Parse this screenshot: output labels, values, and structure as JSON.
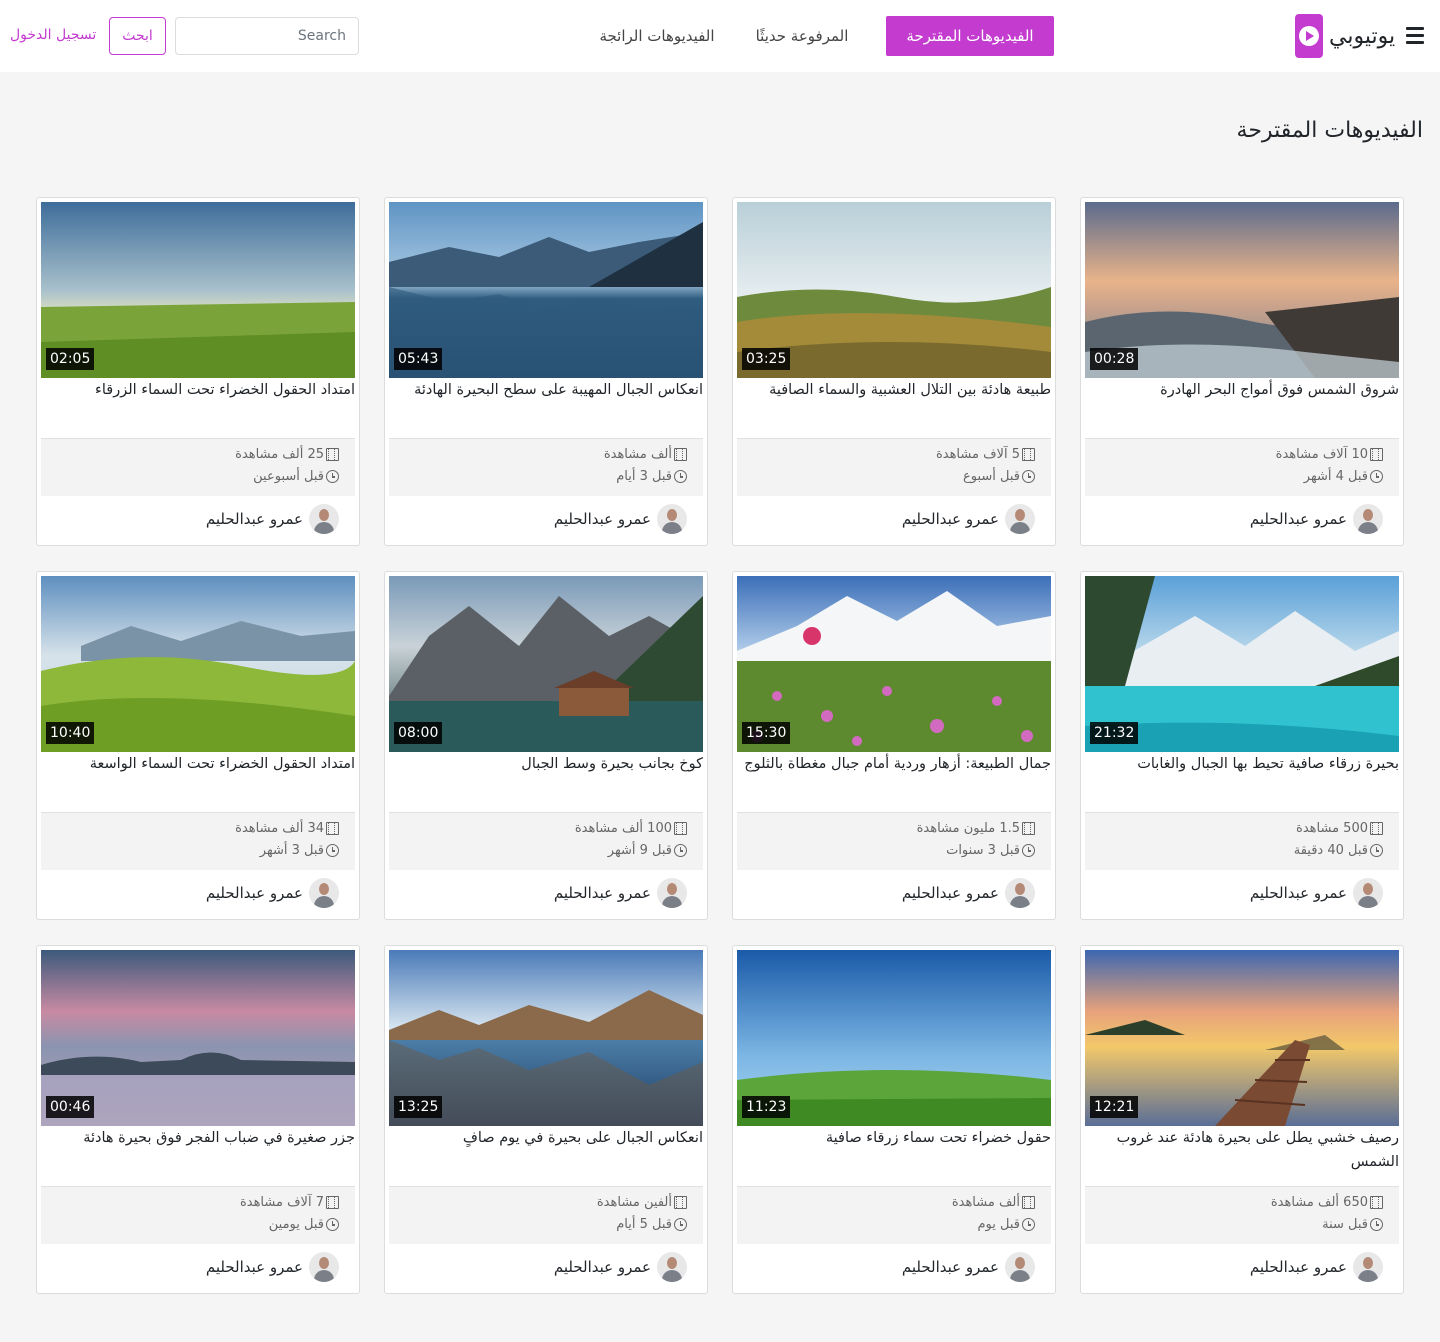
{
  "brand": {
    "name": "يوتيوبي",
    "accent": "#c33ccf"
  },
  "nav": {
    "suggested": "الفيديوهات المقترحة",
    "recent": "المرفوعة حديثًا",
    "trending": "الفيديوهات الرائجة"
  },
  "search": {
    "placeholder": "Search",
    "value": "",
    "button": "ابحث"
  },
  "login": "تسجيل الدخول",
  "page_title": "الفيديوهات المقترحة",
  "videos": [
    {
      "title": "شروق الشمس فوق أمواج البحر الهادرة",
      "duration": "00:28",
      "views": "10 آلاف مشاهدة",
      "time": "قبل 4 أشهر",
      "author": "عمرو عبدالحليم",
      "scene": "sea-sunrise"
    },
    {
      "title": "طبيعة هادئة بين التلال العشبية والسماء الصافية",
      "duration": "03:25",
      "views": "5 آلاف مشاهدة",
      "time": "قبل أسبوع",
      "author": "عمرو عبدالحليم",
      "scene": "grass-hills"
    },
    {
      "title": "انعكاس الجبال المهيبة على سطح البحيرة الهادئة",
      "duration": "05:43",
      "views": "ألف مشاهدة",
      "time": "قبل 3 أيام",
      "author": "عمرو عبدالحليم",
      "scene": "mountain-lake-blue"
    },
    {
      "title": "امتداد الحقول الخضراء تحت السماء الزرقاء",
      "duration": "02:05",
      "views": "25 ألف مشاهدة",
      "time": "قبل أسبوعين",
      "author": "عمرو عبدالحليم",
      "scene": "green-field"
    },
    {
      "title": "بحيرة زرقاء صافية تحيط بها الجبال والغابات",
      "duration": "21:32",
      "views": "500 مشاهدة",
      "time": "قبل 40 دقيقة",
      "author": "عمرو عبدالحليم",
      "scene": "turquoise-lake"
    },
    {
      "title": "جمال الطبيعة: أزهار وردية أمام جبال مغطاة بالثلوج",
      "duration": "15:30",
      "views": "1.5 مليون مشاهدة",
      "time": "قبل 3 سنوات",
      "author": "عمرو عبدالحليم",
      "scene": "pink-flowers"
    },
    {
      "title": "كوخ بجانب بحيرة وسط الجبال",
      "duration": "08:00",
      "views": "100 ألف مشاهدة",
      "time": "قبل 9 أشهر",
      "author": "عمرو عبدالحليم",
      "scene": "lake-cabin"
    },
    {
      "title": "امتداد الحقول الخضراء تحت السماء الواسعة",
      "duration": "10:40",
      "views": "34 ألف مشاهدة",
      "time": "قبل 3 أشهر",
      "author": "عمرو عبدالحليم",
      "scene": "rolling-hills"
    },
    {
      "title": "رصيف خشبي يطل على بحيرة هادئة عند غروب الشمس",
      "duration": "12:21",
      "views": "650 ألف مشاهدة",
      "time": "قبل سنة",
      "author": "عمرو عبدالحليم",
      "scene": "pier-sunset"
    },
    {
      "title": "حقول خضراء تحت سماء زرقاء صافية",
      "duration": "11:23",
      "views": "ألف مشاهدة",
      "time": "قبل يوم",
      "author": "عمرو عبدالحليم",
      "scene": "green-blue-sky"
    },
    {
      "title": "انعكاس الجبال على بحيرة في يوم صافٍ",
      "duration": "13:25",
      "views": "ألفين مشاهدة",
      "time": "قبل 5 أيام",
      "author": "عمرو عبدالحليم",
      "scene": "reflection-lake"
    },
    {
      "title": "جزر صغيرة في ضباب الفجر فوق بحيرة هادئة",
      "duration": "00:46",
      "views": "7 آلاف مشاهدة",
      "time": "قبل يومين",
      "author": "عمرو عبدالحليم",
      "scene": "misty-islands"
    }
  ]
}
